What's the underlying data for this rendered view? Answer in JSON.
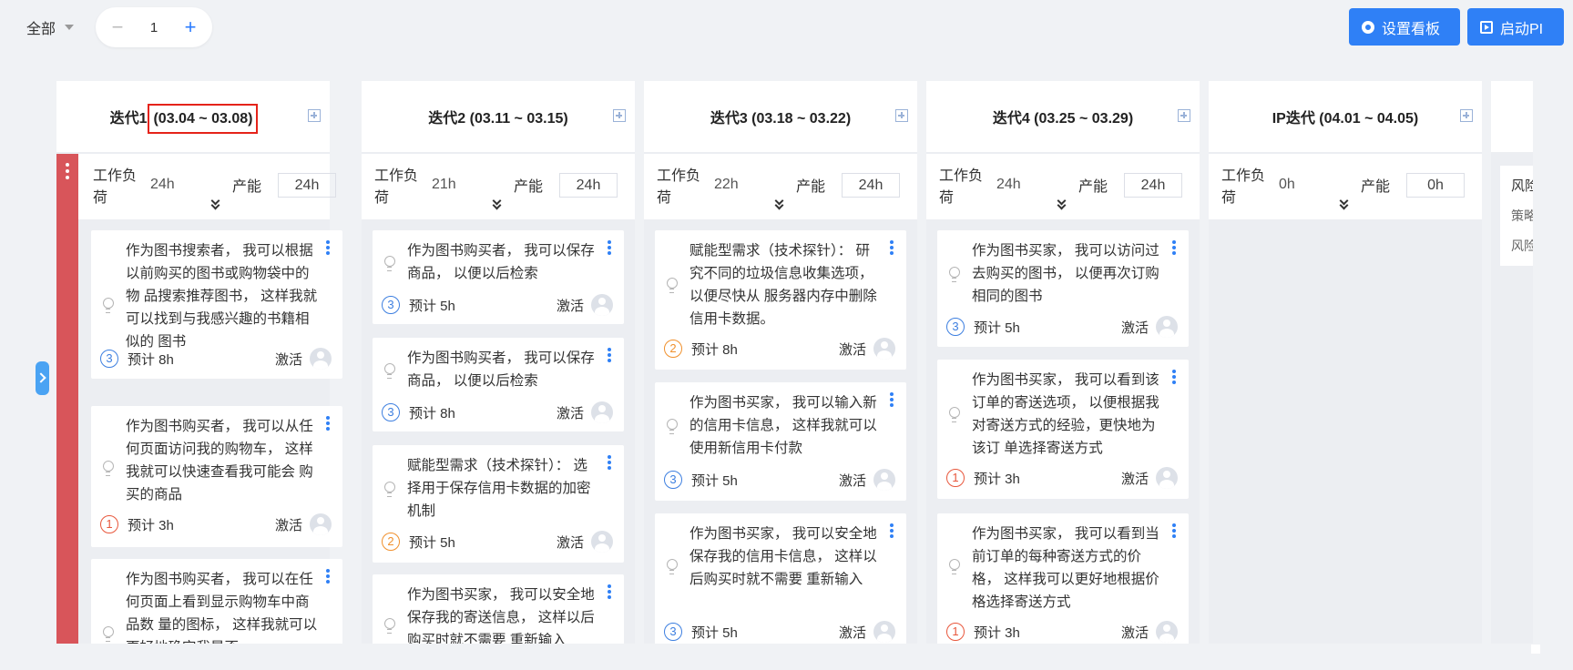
{
  "toolbar": {
    "scope_label": "全部",
    "page_value": "1",
    "minus_symbol": "−",
    "plus_symbol": "+",
    "settings_label": "设置看板",
    "start_label": "启动PI"
  },
  "columns": [
    {
      "title_prefix": "迭代1",
      "title_range": "(03.04 ~ 03.08)",
      "workload_label": "工作负荷",
      "workload": "24h",
      "capacity_label": "产能",
      "capacity": "24h",
      "cards": [
        {
          "text": "作为图书搜索者， 我可以根据以前购买的图书或购物袋中的物 品搜索推荐图书， 这样我就可以找到与我感兴趣的书籍相似的 图书",
          "priority": "3",
          "estimate": "预计 8h",
          "status": "激活"
        },
        {
          "text": "作为图书购买者， 我可以从任何页面访问我的购物车， 这样我就可以快速查看我可能会 购买的商品",
          "priority": "1",
          "estimate": "预计 3h",
          "status": "激活"
        },
        {
          "text": "作为图书购买者， 我可以在任何页面上看到显示购物车中商品数 量的图标， 这样我就可以更好地确定我是否",
          "priority": "",
          "estimate": "",
          "status": ""
        }
      ]
    },
    {
      "title_prefix": "迭代2 (03.11 ~ 03.15)",
      "title_range": "",
      "workload_label": "工作负荷",
      "workload": "21h",
      "capacity_label": "产能",
      "capacity": "24h",
      "cards": [
        {
          "text": "作为图书购买者， 我可以保存商品， 以便以后检索",
          "priority": "3",
          "estimate": "预计 5h",
          "status": "激活"
        },
        {
          "text": "作为图书购买者， 我可以保存商品， 以便以后检索",
          "priority": "3",
          "estimate": "预计 8h",
          "status": "激活"
        },
        {
          "text": "赋能型需求（技术探针）： 选择用于保存信用卡数据的加密机制",
          "priority": "2",
          "estimate": "预计 5h",
          "status": "激活"
        },
        {
          "text": "作为图书买家， 我可以安全地保存我的寄送信息， 这样以后购买时就不需要 重新输入",
          "priority": "",
          "estimate": "",
          "status": ""
        }
      ]
    },
    {
      "title_prefix": "迭代3 (03.18 ~ 03.22)",
      "title_range": "",
      "workload_label": "工作负荷",
      "workload": "22h",
      "capacity_label": "产能",
      "capacity": "24h",
      "cards": [
        {
          "text": "赋能型需求（技术探针）： 研究不同的垃圾信息收集选项，以便尽快从 服务器内存中删除信用卡数据。",
          "priority": "2",
          "estimate": "预计 8h",
          "status": "激活"
        },
        {
          "text": "作为图书买家， 我可以输入新的信用卡信息， 这样我就可以使用新信用卡付款",
          "priority": "3",
          "estimate": "预计 5h",
          "status": "激活"
        },
        {
          "text": "作为图书买家， 我可以安全地保存我的信用卡信息， 这样以后购买时就不需要 重新输入",
          "priority": "3",
          "estimate": "预计 5h",
          "status": "激活"
        }
      ]
    },
    {
      "title_prefix": "迭代4 (03.25 ~ 03.29)",
      "title_range": "",
      "workload_label": "工作负荷",
      "workload": "24h",
      "capacity_label": "产能",
      "capacity": "24h",
      "cards": [
        {
          "text": "作为图书买家， 我可以访问过去购买的图书， 以便再次订购相同的图书",
          "priority": "3",
          "estimate": "预计 5h",
          "status": "激活"
        },
        {
          "text": "作为图书买家， 我可以看到该订单的寄送选项， 以便根据我对寄送方式的经验，更快地为该订 单选择寄送方式",
          "priority": "1",
          "estimate": "预计 3h",
          "status": "激活"
        },
        {
          "text": "作为图书买家， 我可以看到当前订单的每种寄送方式的价格， 这样我可以更好地根据价格选择寄送方式",
          "priority": "1",
          "estimate": "预计 3h",
          "status": "激活"
        }
      ]
    },
    {
      "title_prefix": "IP迭代 (04.01 ~ 04.05)",
      "title_range": "",
      "workload_label": "工作负荷",
      "workload": "0h",
      "capacity_label": "产能",
      "capacity": "0h",
      "cards": []
    }
  ],
  "side_panel": {
    "line1": "风险",
    "line2": "策略",
    "line3": "风险"
  },
  "colors": {
    "accent": "#2f80f6",
    "swimlane": "#d8555a",
    "highlight_box": "#e5231a",
    "priority_1": "#e8573c",
    "priority_2": "#f0902c",
    "priority_3": "#3d7fe0"
  }
}
